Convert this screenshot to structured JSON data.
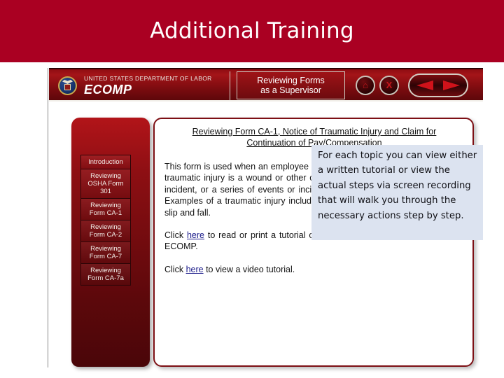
{
  "slide": {
    "title": "Additional Training"
  },
  "app": {
    "agency_line": "UNITED STATES DEPARTMENT OF LABOR",
    "brand": "ECOMP",
    "subtitle_line1": "Reviewing Forms",
    "subtitle_line2": "as a Supervisor",
    "icons": {
      "home": "⌂",
      "close": "X",
      "back_arrow": "back-arrow",
      "forward_arrow": "forward-arrow"
    },
    "colors": {
      "title_band": "#aa0022",
      "header_red": "#a41418",
      "panel_red": "#8d0f13",
      "callout_bg": "#dce3f0",
      "link": "#1b1b8a"
    }
  },
  "menu": {
    "items": [
      {
        "label": "Introduction"
      },
      {
        "label": "Reviewing OSHA Form 301"
      },
      {
        "label": "Reviewing Form CA-1"
      },
      {
        "label": "Reviewing Form CA-2"
      },
      {
        "label": "Reviewing Form CA-7"
      },
      {
        "label": "Reviewing Form CA-7a"
      }
    ]
  },
  "content": {
    "heading_line1": "Reviewing Form CA-1, Notice of Traumatic Injury and Claim for",
    "heading_line2": "Continuation of Pay/Compensation",
    "paragraph": "This form is used when an employee sustains a traumatic injury on the job. A traumatic injury is a wound or other condition caused by a specific event or incident, or a series of events or incidents, within a single workday or shift. Examples of a traumatic injury include: a dog bite, a fall from a ladder, or a slip and fall.",
    "link_para_1_pre": "Click ",
    "link_para_1_link": "here",
    "link_para_1_post": " to read or print a tutorial on reviewing a CA-1 as a supervisor in ECOMP.",
    "link_para_2_pre": "Click ",
    "link_para_2_link": "here",
    "link_para_2_post": " to view a video tutorial."
  },
  "callout": {
    "text": "For each topic you can view either a written tutorial or view the actual steps via screen recording that will walk you through the necessary actions step by step."
  }
}
